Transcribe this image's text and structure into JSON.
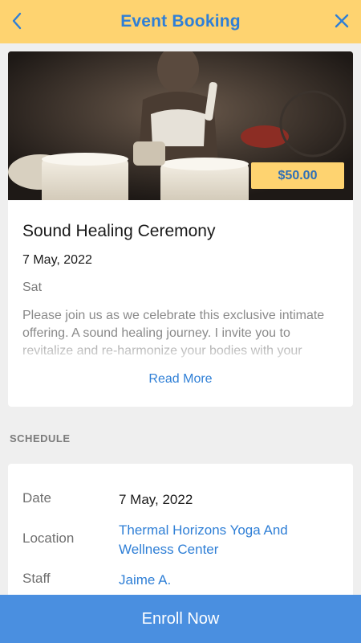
{
  "header": {
    "title": "Event Booking",
    "back_icon": "chevron-left-icon",
    "close_icon": "close-icon"
  },
  "event": {
    "price": "$50.00",
    "title": "Sound Healing Ceremony",
    "date": "7 May, 2022",
    "day": "Sat",
    "description": "Please join us as we celebrate this exclusive intimate offering. A sound healing journey. I invite you to revitalize and re-harmonize your bodies with your",
    "read_more": "Read More"
  },
  "schedule": {
    "section_label": "SCHEDULE",
    "rows": [
      {
        "label": "Date",
        "value": "7 May, 2022"
      },
      {
        "label": "Location",
        "value": "Thermal Horizons Yoga And Wellness Center"
      },
      {
        "label": "Staff",
        "value": "Jaime A."
      }
    ]
  },
  "footer": {
    "enroll_label": "Enroll Now"
  },
  "colors": {
    "header_bg": "#fed370",
    "accent_blue": "#2f7fd6",
    "button_blue": "#4a8fe0",
    "page_bg": "#efefef"
  }
}
